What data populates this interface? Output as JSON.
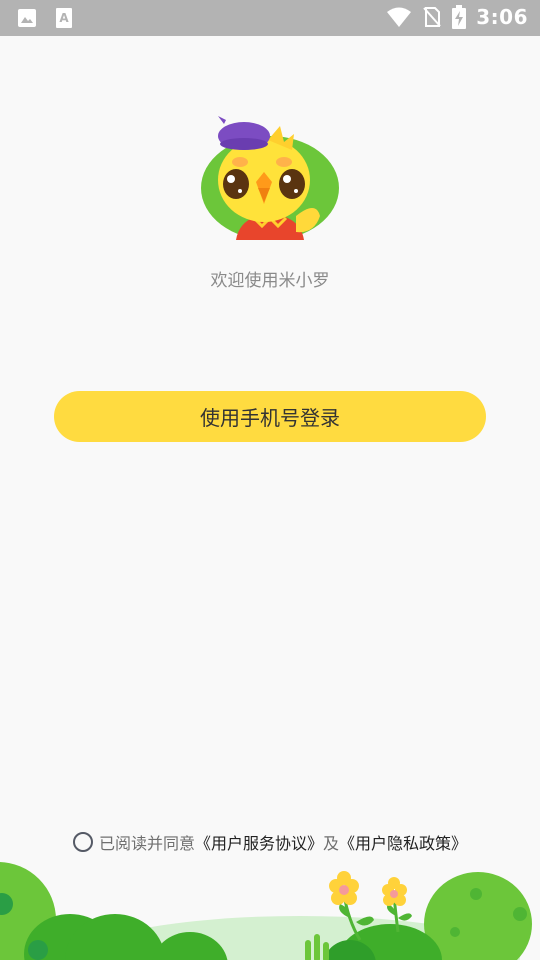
{
  "status_bar": {
    "time": "3:06",
    "left_icons": [
      "gallery-icon",
      "text-icon"
    ],
    "right_icons": [
      "wifi-icon",
      "no-sim-icon",
      "battery-charging-icon"
    ]
  },
  "welcome": {
    "text": "欢迎使用米小罗"
  },
  "login": {
    "button_label": "使用手机号登录"
  },
  "agreement": {
    "checked": false,
    "prefix": "已阅读并同意",
    "terms_link": "《用户服务协议》",
    "connector": "及",
    "privacy_link": "《用户隐私政策》"
  },
  "colors": {
    "primary_button": "#ffdb40",
    "background": "#f9f9f9",
    "status_bar": "#b3b3b3",
    "grass_green": "#6cc63a"
  }
}
